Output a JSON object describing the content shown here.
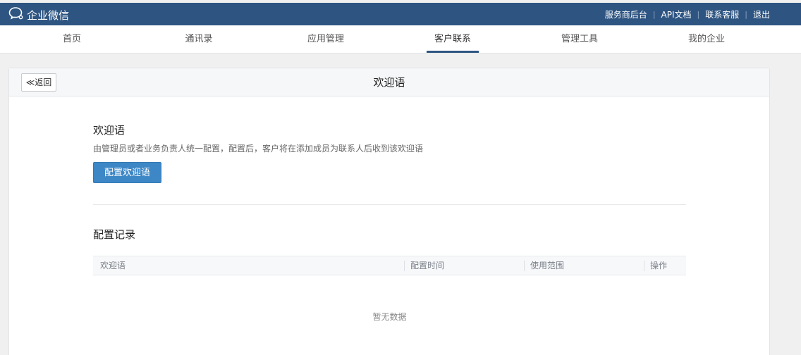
{
  "topbar": {
    "logo_text": "企业微信",
    "logo_icon": "chat-bubble-icon",
    "links": [
      "服务商后台",
      "API文档",
      "联系客服",
      "退出"
    ]
  },
  "nav": {
    "items": [
      "首页",
      "通讯录",
      "应用管理",
      "客户联系",
      "管理工具",
      "我的企业"
    ],
    "active": "客户联系"
  },
  "panel": {
    "back_label": "≪返回",
    "title": "欢迎语"
  },
  "welcome": {
    "heading": "欢迎语",
    "description": "由管理员或者业务负责人统一配置，配置后，客户将在添加成员为联系人后收到该欢迎语",
    "button_label": "配置欢迎语"
  },
  "records": {
    "heading": "配置记录",
    "columns": [
      "欢迎语",
      "配置时间",
      "使用范围",
      "操作"
    ],
    "empty_text": "暂无数据"
  },
  "colors": {
    "topbar": "#2e5582",
    "primary_button": "#3d87c6"
  }
}
